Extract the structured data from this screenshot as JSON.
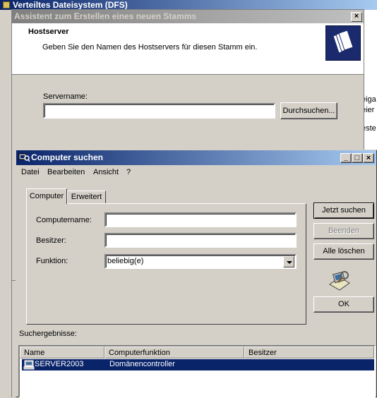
{
  "background_window": {
    "title": "Verteiltes Dateisystem (DFS)",
    "right_fragments": [
      "eiga",
      "eier",
      "este"
    ]
  },
  "wizard": {
    "title": "Assistent zum Erstellen eines neuen Stamms",
    "heading": "Hostserver",
    "subheading": "Geben Sie den Namen des Hostservers für diesen Stamm ein.",
    "servername_label": "Servername:",
    "servername_value": "",
    "browse_button": "Durchsuchen...",
    "close_glyph": "×"
  },
  "find_dialog": {
    "title": "Computer suchen",
    "window_controls": {
      "minimize": "_",
      "maximize": "□",
      "close": "×"
    },
    "menu": [
      "Datei",
      "Bearbeiten",
      "Ansicht",
      "?"
    ],
    "tabs": [
      "Computer",
      "Erweitert"
    ],
    "active_tab": "Computer",
    "fields": {
      "computername_label": "Computername:",
      "computername_value": "",
      "owner_label": "Besitzer:",
      "owner_value": "",
      "role_label": "Funktion:",
      "role_value": "beliebig(e)"
    },
    "buttons": {
      "search_now": "Jetzt suchen",
      "stop": "Beenden",
      "clear_all": "Alle löschen",
      "ok": "OK"
    },
    "results_label": "Suchergebnisse:",
    "results_columns": [
      "Name",
      "Computerfunktion",
      "Besitzer"
    ],
    "results_rows": [
      {
        "name": "SERVER2003",
        "role": "Domänencontroller",
        "owner": ""
      }
    ],
    "colors": {
      "selection": "#0a246a",
      "title_active": "#0a246a",
      "title_inactive": "#808080"
    }
  }
}
